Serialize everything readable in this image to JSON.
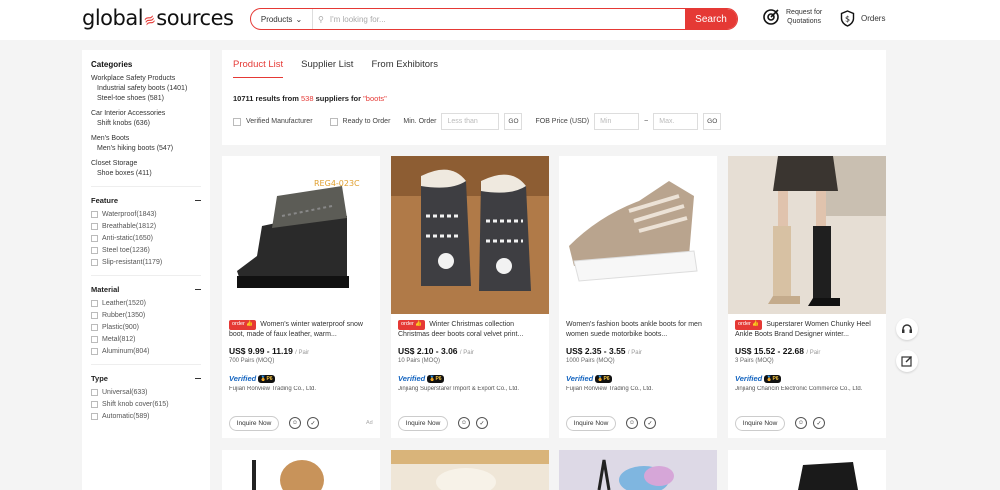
{
  "header": {
    "logo_left": "global",
    "logo_right": "sources",
    "search_category": "Products",
    "search_placeholder": "I'm looking for...",
    "search_button": "Search",
    "rfq_line1": "Request for",
    "rfq_line2": "Quotations",
    "orders_label": "Orders"
  },
  "sidebar": {
    "categories_title": "Categories",
    "categories": [
      {
        "name": "Workplace Safety Products",
        "subs": [
          "Industrial safety boots (1401)",
          "Steel-toe shoes (581)"
        ]
      },
      {
        "name": "Car Interior Accessories",
        "subs": [
          "Shift knobs (636)"
        ]
      },
      {
        "name": "Men's Boots",
        "subs": [
          "Men's hiking boots (547)"
        ]
      },
      {
        "name": "Closet Storage",
        "subs": [
          "Shoe boxes (411)"
        ]
      }
    ],
    "feature_title": "Feature",
    "feature": [
      "Waterproof(1843)",
      "Breathable(1812)",
      "Anti-static(1650)",
      "Steel toe(1236)",
      "Slip-resistant(1179)"
    ],
    "material_title": "Material",
    "material": [
      "Leather(1520)",
      "Rubber(1350)",
      "Plastic(900)",
      "Metal(812)",
      "Aluminum(804)"
    ],
    "type_title": "Type",
    "type": [
      "Universal(633)",
      "Shift knob cover(615)",
      "Automatic(589)"
    ]
  },
  "tabs": [
    "Product List",
    "Supplier List",
    "From Exhibitors"
  ],
  "results": {
    "count": "10711",
    "results_from": "results from",
    "suppliers": "538",
    "suppliers_for": "suppliers for",
    "keyword": "\"boots\""
  },
  "filters": {
    "verified": "Verified Manufacturer",
    "ready": "Ready to Order",
    "min_order": "Min. Order",
    "less_than": "Less than",
    "go": "GO",
    "fob": "FOB Price (USD)",
    "min": "Min",
    "dash": "~",
    "max": "Max."
  },
  "products": [
    {
      "tag": "order 👍",
      "title": "Women's winter waterproof snow boot, made of faux leather, warm...",
      "price": "US$ 9.99 - 11.19",
      "unit": "/ Pair",
      "moq": "700 Pairs (MOQ)",
      "verified": "Verified",
      "badge": "🏅P6",
      "supplier": "Fujian Ronview Trading Co., Ltd.",
      "inquire": "Inquire Now",
      "ad": "Ad"
    },
    {
      "tag": "order 👍",
      "title": "Winter Christmas collection Christmas deer boots coral velvet print...",
      "price": "US$ 2.10 - 3.06",
      "unit": "/ Pair",
      "moq": "10 Pairs (MOQ)",
      "verified": "Verified",
      "badge": "🏅P6",
      "supplier": "Jinjiang Superstarer Import & Export Co., Ltd.",
      "inquire": "Inquire Now",
      "ad": ""
    },
    {
      "tag": "",
      "title": "Women's fashion boots ankle boots for men women suede motorbike boots...",
      "price": "US$ 2.35 - 3.55",
      "unit": "/ Pair",
      "moq": "1000 Pairs (MOQ)",
      "verified": "Verified",
      "badge": "🏅P6",
      "supplier": "Fujian Ronview Trading Co., Ltd.",
      "inquire": "Inquire Now",
      "ad": ""
    },
    {
      "tag": "order 👍",
      "title": "Superstarer Women Chunky Heel Ankle Boots Brand Designer winter...",
      "price": "US$ 15.52 - 22.68",
      "unit": "/ Pair",
      "moq": "3 Pairs (MOQ)",
      "verified": "Verified",
      "badge": "🏅P6",
      "supplier": "Jinjiang Chancin Electronic Commerce Co., Ltd.",
      "inquire": "Inquire Now",
      "ad": ""
    }
  ],
  "image_label_1": "REG4-023C",
  "colors": {
    "accent": "#e53935",
    "verified": "#1565c0"
  }
}
